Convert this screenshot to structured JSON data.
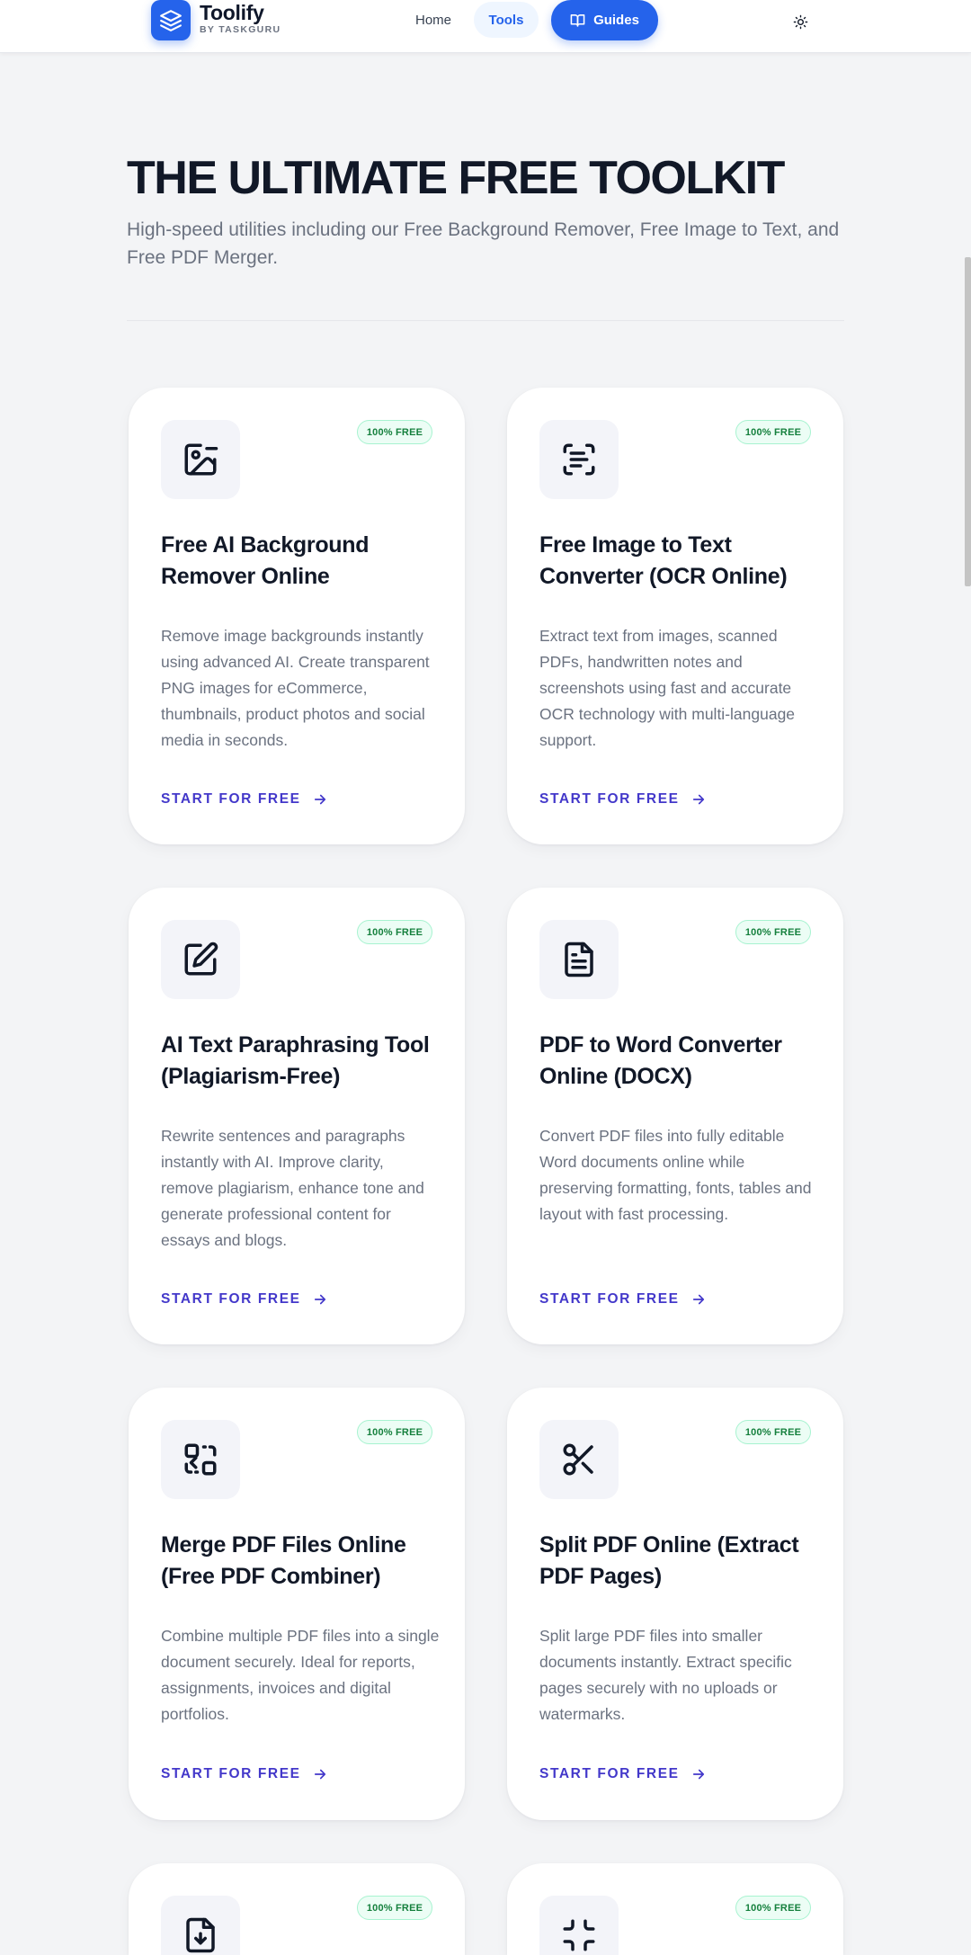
{
  "header": {
    "brand_name": "Toolify",
    "brand_sub": "BY TASKGURU",
    "nav_home": "Home",
    "nav_tools": "Tools",
    "nav_guides": "Guides",
    "accent_color": "#2563eb"
  },
  "hero": {
    "title": "THE ULTIMATE FREE TOOLKIT",
    "subtitle": "High-speed utilities including our Free Background Remover, Free Image to Text, and Free PDF Merger."
  },
  "cards": [
    {
      "icon": "image-icon",
      "badge": "100% FREE",
      "title": "Free AI Background Remover Online",
      "description": "Remove image backgrounds instantly using advanced AI. Create transparent PNG images for eCommerce, thumbnails, product photos and social media in seconds.",
      "cta": "START FOR FREE"
    },
    {
      "icon": "scan-text-icon",
      "badge": "100% FREE",
      "title": "Free Image to Text Converter (OCR Online)",
      "description": "Extract text from images, scanned PDFs, handwritten notes and screenshots using fast and accurate OCR technology with multi-language support.",
      "cta": "START FOR FREE"
    },
    {
      "icon": "edit-icon",
      "badge": "100% FREE",
      "title": "AI Text Paraphrasing Tool (Plagiarism-Free)",
      "description": "Rewrite sentences and paragraphs instantly with AI. Improve clarity, remove plagiarism, enhance tone and generate professional content for essays and blogs.",
      "cta": "START FOR FREE"
    },
    {
      "icon": "file-text-icon",
      "badge": "100% FREE",
      "title": "PDF to Word Converter Online (DOCX)",
      "description": "Convert PDF files into fully editable Word documents online while preserving formatting, fonts, tables and layout with fast processing.",
      "cta": "START FOR FREE"
    },
    {
      "icon": "merge-icon",
      "badge": "100% FREE",
      "title": "Merge PDF Files Online (Free PDF Combiner)",
      "description": "Combine multiple PDF files into a single document securely. Ideal for reports, assignments, invoices and digital portfolios.",
      "cta": "START FOR FREE"
    },
    {
      "icon": "scissors-icon",
      "badge": "100% FREE",
      "title": "Split PDF Online (Extract PDF Pages)",
      "description": "Split large PDF files into smaller documents instantly. Extract specific pages securely with no uploads or watermarks.",
      "cta": "START FOR FREE"
    },
    {
      "icon": "file-download-icon",
      "badge": "100% FREE"
    },
    {
      "icon": "compress-icon",
      "badge": "100% FREE"
    }
  ]
}
